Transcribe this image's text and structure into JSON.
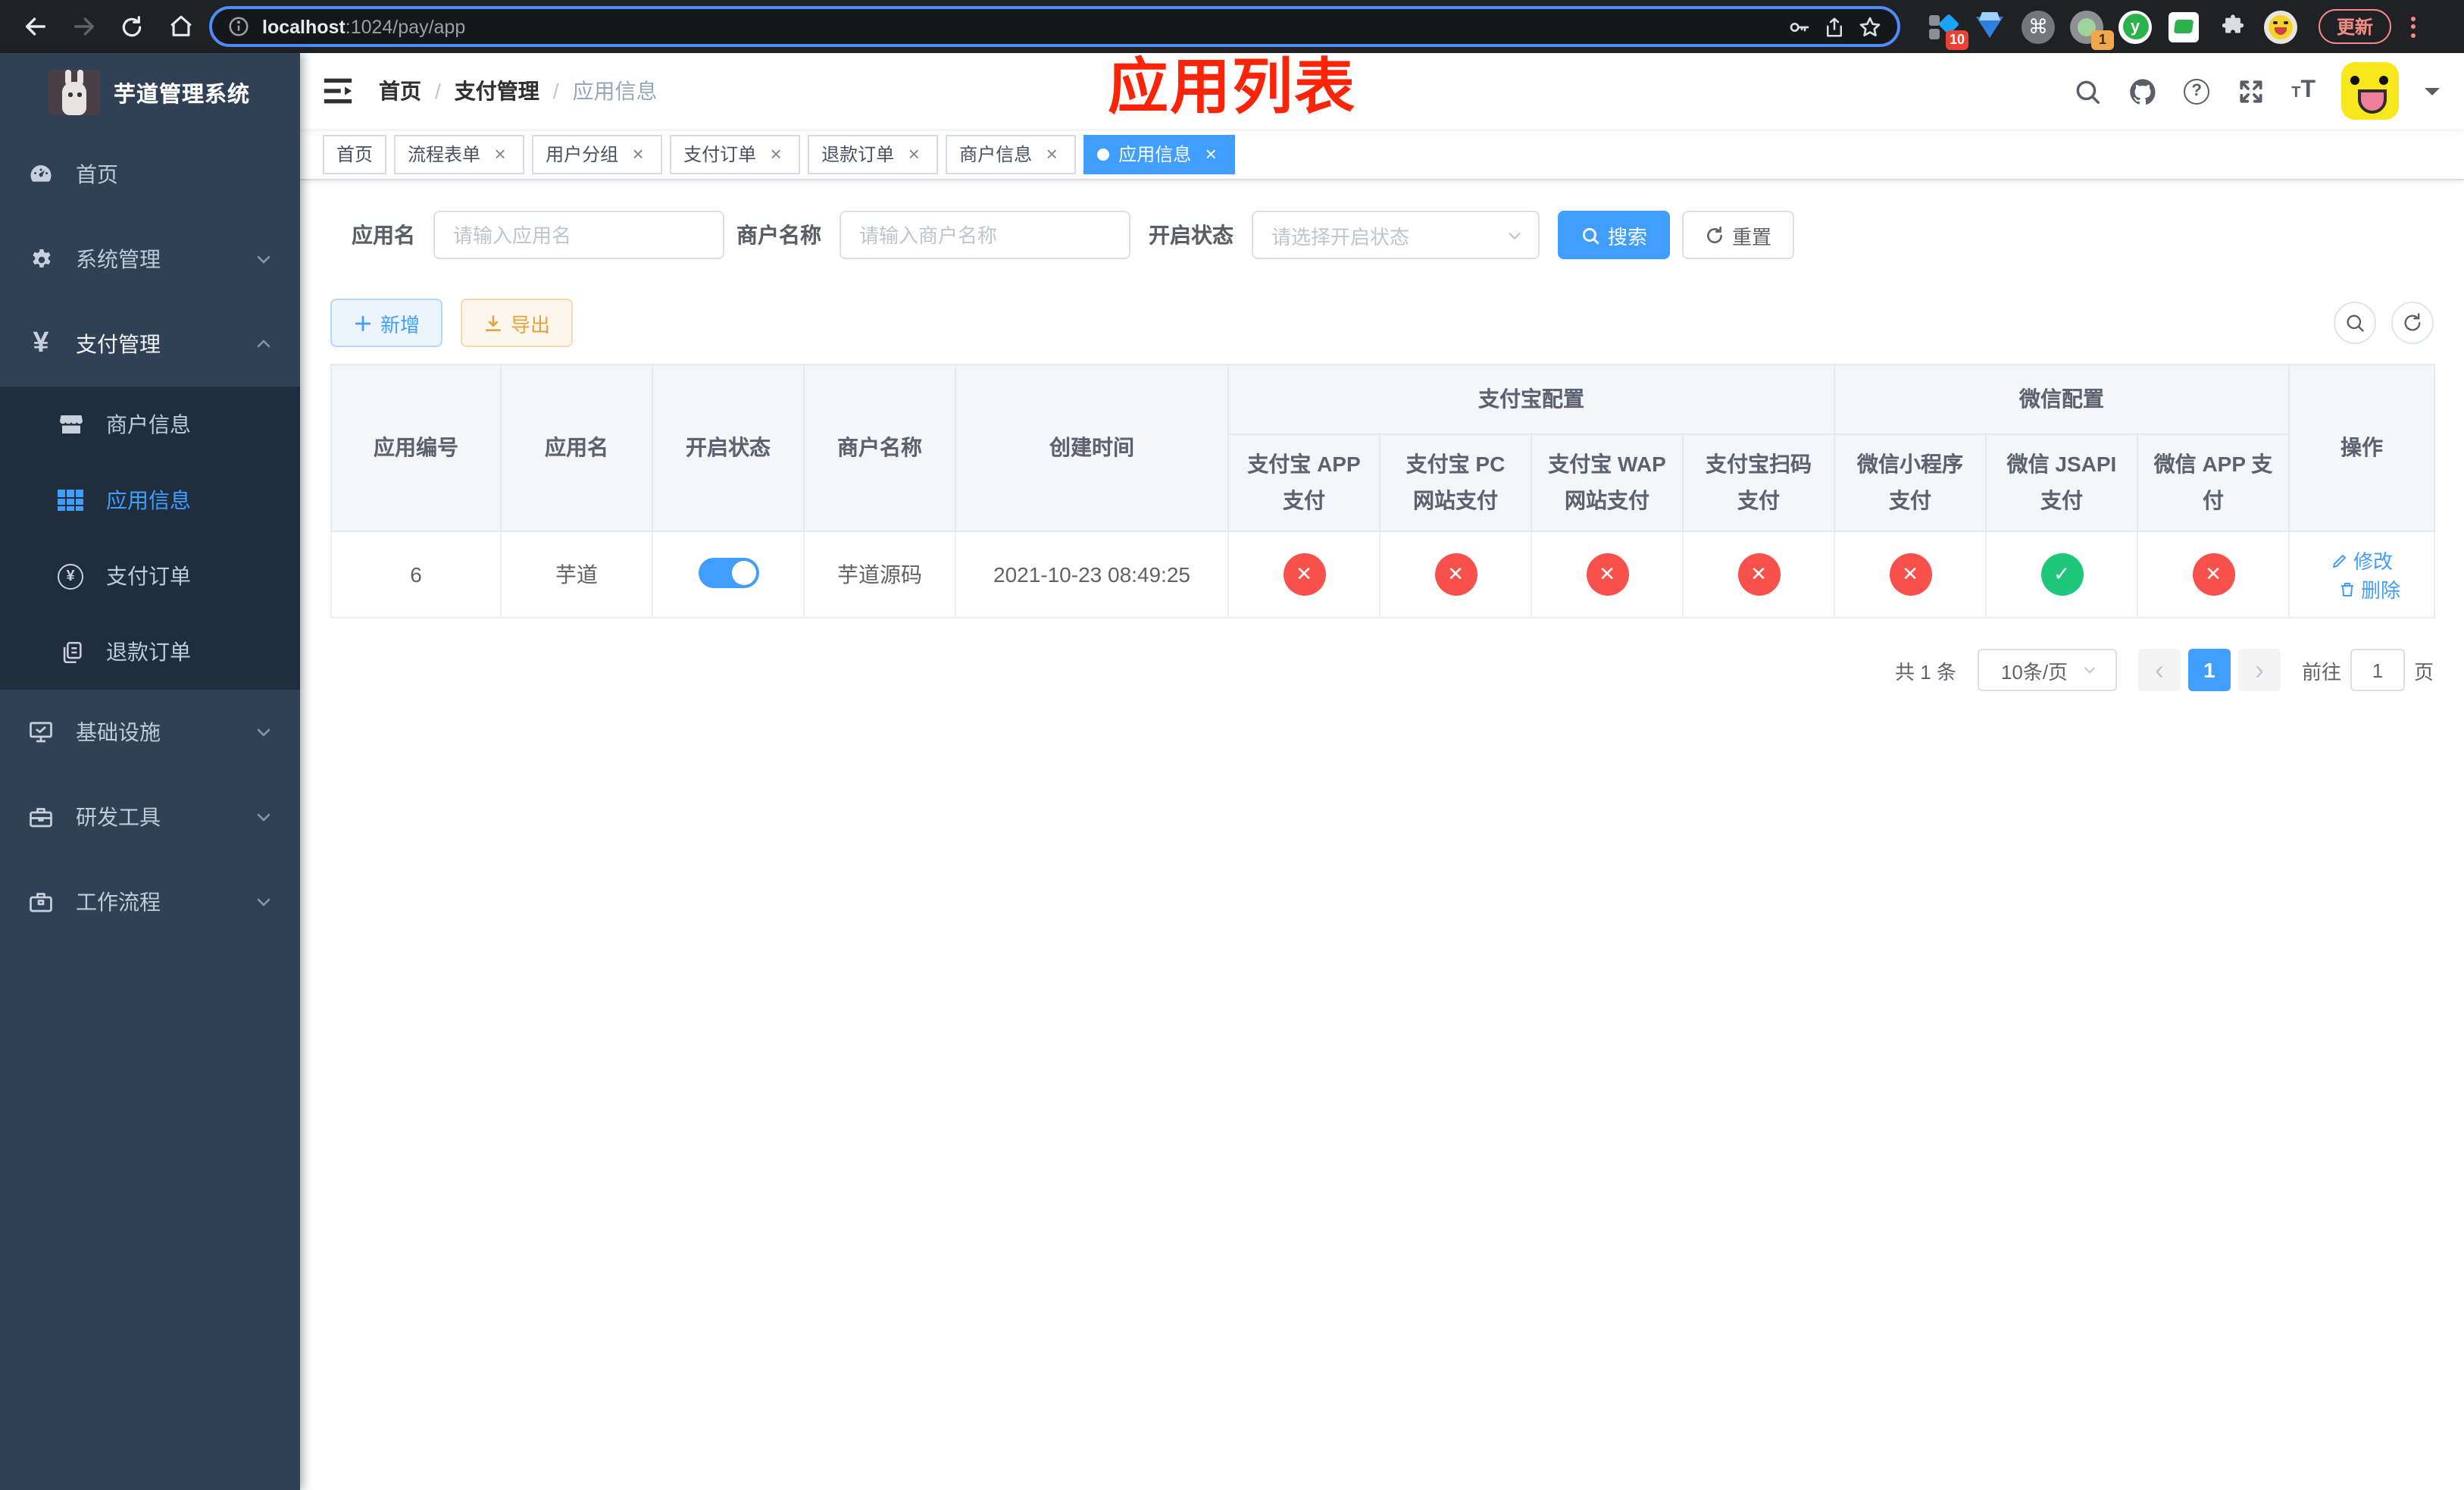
{
  "browser": {
    "url_host": "localhost",
    "url_rest": ":1024/pay/app",
    "update_label": "更新",
    "ext_badge_1": "10",
    "ext_badge_2": "1"
  },
  "sidebar": {
    "title": "芋道管理系统",
    "items": [
      {
        "label": "首页"
      },
      {
        "label": "系统管理"
      },
      {
        "label": "支付管理"
      },
      {
        "label": "商户信息"
      },
      {
        "label": "应用信息"
      },
      {
        "label": "支付订单"
      },
      {
        "label": "退款订单"
      },
      {
        "label": "基础设施"
      },
      {
        "label": "研发工具"
      },
      {
        "label": "工作流程"
      }
    ]
  },
  "navbar": {
    "breadcrumb": [
      "首页",
      "支付管理",
      "应用信息"
    ],
    "annotation": "应用列表"
  },
  "tabs": [
    {
      "label": "首页"
    },
    {
      "label": "流程表单"
    },
    {
      "label": "用户分组"
    },
    {
      "label": "支付订单"
    },
    {
      "label": "退款订单"
    },
    {
      "label": "商户信息"
    },
    {
      "label": "应用信息"
    }
  ],
  "filters": {
    "app_name_label": "应用名",
    "app_name_placeholder": "请输入应用名",
    "merchant_label": "商户名称",
    "merchant_placeholder": "请输入商户名称",
    "status_label": "开启状态",
    "status_placeholder": "请选择开启状态",
    "search_label": "搜索",
    "reset_label": "重置"
  },
  "toolbar": {
    "add_label": "新增",
    "export_label": "导出"
  },
  "table": {
    "main_columns": [
      "应用编号",
      "应用名",
      "开启状态",
      "商户名称",
      "创建时间"
    ],
    "group_alipay": "支付宝配置",
    "group_wechat": "微信配置",
    "alipay_columns": [
      "支付宝 APP 支付",
      "支付宝 PC 网站支付",
      "支付宝 WAP 网站支付",
      "支付宝扫码支付"
    ],
    "wechat_columns": [
      "微信小程序支付",
      "微信 JSAPI 支付",
      "微信 APP 支付"
    ],
    "actions_column": "操作",
    "row": {
      "app_id": "6",
      "app_name": "芋道",
      "enabled": true,
      "merchant_name": "芋道源码",
      "create_time": "2021-10-23 08:49:25",
      "statuses": [
        "disabled",
        "disabled",
        "disabled",
        "disabled",
        "disabled",
        "enabled",
        "disabled"
      ],
      "edit_label": "修改",
      "delete_label": "删除"
    }
  },
  "pagination": {
    "total": "共 1 条",
    "page_size": "10条/页",
    "current_page": "1",
    "goto_label": "前往",
    "goto_value": "1",
    "page_label": "页"
  },
  "colors": {
    "primary": "#409eff",
    "success_icon": "#1ec77b",
    "danger_icon": "#f8514c",
    "warning": "#e6a23c",
    "sidebar_bg": "#304156",
    "submenu_bg": "#1f2d3d",
    "annotation_red": "#fb2409",
    "chrome_update": "#f28b82"
  }
}
